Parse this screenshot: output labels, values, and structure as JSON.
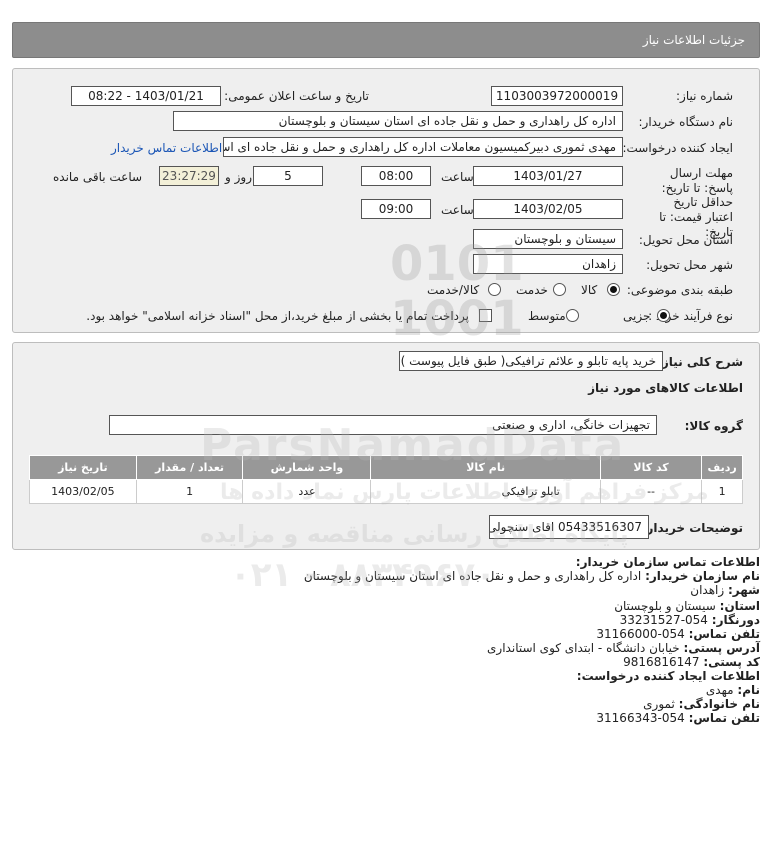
{
  "header": {
    "title": "جزئیات اطلاعات نیاز"
  },
  "fields": {
    "need_number_label": "شماره نیاز:",
    "need_number": "1103003972000019",
    "announce_label": "تاریخ و ساعت اعلان عمومی:",
    "announce_value": "1403/01/21 - 08:22",
    "buyer_org_label": "نام دستگاه خریدار:",
    "buyer_org": "اداره کل راهداری و حمل و نقل جاده ای استان سیستان و بلوچستان",
    "creator_label": "ایجاد کننده درخواست:",
    "creator": "مهدی ثموری دبیرکمیسیون معاملات اداره کل راهداری و حمل و نقل جاده ای اس",
    "contact_link": "اطلاعات تماس خریدار",
    "deadline_label": "مهلت ارسال پاسخ: تا تاریخ:",
    "deadline_date": "1403/01/27",
    "time_word": "ساعت",
    "deadline_time": "08:00",
    "days_value": "5",
    "days_word": "روز و",
    "remaining_value": "23:27:29",
    "remaining_label": "ساعت باقی مانده",
    "validity_label": "حداقل تاریخ اعتبار قیمت: تا تاریخ:",
    "validity_date": "1403/02/05",
    "validity_time": "09:00",
    "province_label": "استان محل تحویل:",
    "province": "سیستان و بلوچستان",
    "city_label": "شهر محل تحویل:",
    "city": "زاهدان",
    "category_label": "طبقه بندی موضوعی:",
    "category_options": [
      "کالا",
      "خدمت",
      "کالا/خدمت"
    ],
    "category_selected": "کالا",
    "process_label": "نوع فرآیند خرید :",
    "process_options": [
      "جزیی",
      "متوسط"
    ],
    "process_selected": "جزیی",
    "payment_text": "پرداخت تمام یا بخشی از مبلغ خرید،از محل \"اسناد خزانه اسلامی\" خواهد بود."
  },
  "description": {
    "label": "شرح کلی نیاز:",
    "value": "خرید پایه تابلو و علائم ترافیکی( طبق فایل پیوست )"
  },
  "goods_section": {
    "title": "اطلاعات کالاهای مورد نیاز",
    "group_label": "گروه کالا:",
    "group_value": "تجهیزات خانگی، اداری و صنعتی",
    "columns": [
      "ردیف",
      "کد کالا",
      "نام کالا",
      "واحد شمارش",
      "تعداد / مقدار",
      "تاریخ نیاز"
    ],
    "rows": [
      [
        "1",
        "--",
        "تابلو ترافیکی",
        "عدد",
        "1",
        "1403/02/05"
      ]
    ],
    "buyer_notes_label": "توضیحات خریدار:",
    "buyer_notes": "05433516307 اقای سنچولی"
  },
  "contact": {
    "title": "اطلاعات تماس سازمان خریدار:",
    "org_label": "نام سازمان خریدار:",
    "org": "اداره کل راهداری و حمل و نقل جاده ای استان سیستان و بلوچستان",
    "city_label": "شهر:",
    "city": "زاهدان",
    "province_label": "استان:",
    "province": "سیستان و بلوچستان",
    "fax_label": "دورنگار:",
    "fax": "054-33231527",
    "phone_label": "تلفن تماس:",
    "phone": "054-31166000",
    "address_label": "آدرس پستی:",
    "address": "خیابان دانشگاه - ابتدای کوی استانداری",
    "postal_label": "کد پستی:",
    "postal": "9816816147",
    "creator_title": "اطلاعات ایجاد کننده درخواست:",
    "first_name_label": "نام:",
    "first_name": "مهدی",
    "last_name_label": "نام خانوادگی:",
    "last_name": "ثموری",
    "creator_phone_label": "تلفن تماس:",
    "creator_phone": "054-31166343"
  },
  "watermark": {
    "brand": "ParsNamadData",
    "line1": "مرکز فراهم آوری اطلاعات پارس نماد داده ها",
    "line2": "پایگاه اطلاع رسانی مناقصه و مزایده",
    "phone": "۰۲۱ - ۸۸۳۴۹۶۷۰"
  }
}
